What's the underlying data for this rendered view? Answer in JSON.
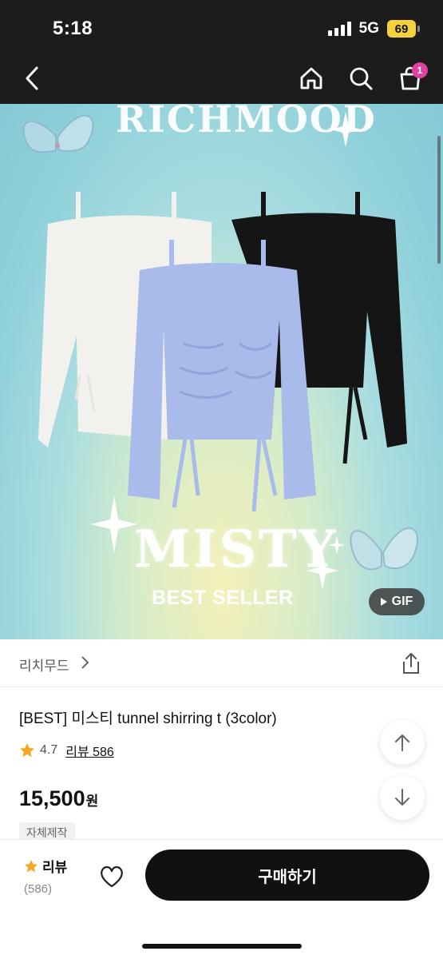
{
  "status_bar": {
    "time": "5:18",
    "network": "5G",
    "battery": "69"
  },
  "nav": {
    "cart_count": "1"
  },
  "hero": {
    "brand_text": "RICHMOOD",
    "title": "MISTY",
    "subtitle": "BEST SELLER",
    "gif_label": "GIF",
    "colors": {
      "white_top": "#f3f1ee",
      "blue_top": "#a8bbea",
      "black_top": "#151515"
    }
  },
  "store": {
    "name": "리치무드"
  },
  "product": {
    "title": "[BEST] 미스티 tunnel shirring t (3color)",
    "rating": "4.7",
    "review_label": "리뷰 586",
    "price": "15,500",
    "currency": "원",
    "tag": "자체제작"
  },
  "bottom_bar": {
    "review_label": "리뷰",
    "review_count": "(586)",
    "buy_label": "구매하기"
  },
  "accent_colors": {
    "star": "#f5a623",
    "badge": "#e040a0",
    "button": "#111111"
  }
}
